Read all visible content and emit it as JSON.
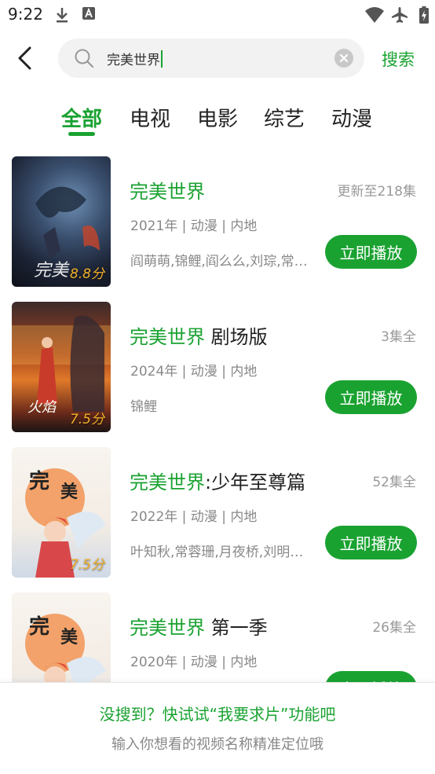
{
  "status_bar": {
    "time": "9:22"
  },
  "search": {
    "query": "完美世界",
    "button_label": "搜索"
  },
  "tabs": [
    {
      "label": "全部",
      "active": true
    },
    {
      "label": "电视",
      "active": false
    },
    {
      "label": "电影",
      "active": false
    },
    {
      "label": "综艺",
      "active": false
    },
    {
      "label": "动漫",
      "active": false
    }
  ],
  "results": [
    {
      "title_highlight": "完美世界",
      "title_rest": "",
      "episodes": "更新至218集",
      "meta": "2021年 | 动漫 | 内地",
      "cast": "阎萌萌,锦鲤,阎么么,刘琮,常…",
      "score": "8.8分",
      "play_label": "立即播放"
    },
    {
      "title_highlight": "完美世界",
      "title_rest": " 剧场版",
      "episodes": "3集全",
      "meta": "2024年 | 动漫 | 内地",
      "cast": "锦鲤",
      "score": "7.5分",
      "play_label": "立即播放"
    },
    {
      "title_highlight": "完美世界",
      "title_rest": ":少年至尊篇",
      "episodes": "52集全",
      "meta": "2022年 | 动漫 | 内地",
      "cast": "叶知秋,常蓉珊,月夜桥,刘明…",
      "score": "7.5分",
      "play_label": "立即播放"
    },
    {
      "title_highlight": "完美世界",
      "title_rest": " 第一季",
      "episodes": "26集全",
      "meta": "2020年 | 动漫 | 内地",
      "cast": "",
      "score": "",
      "play_label": "立即播放"
    }
  ],
  "footer": {
    "prompt": "没搜到？快试试“我要求片”功能吧",
    "hint": "输入你想看的视频名称精准定位哦"
  },
  "colors": {
    "accent": "#1aa231",
    "muted_text": "#888888",
    "score": "#f3b12a"
  }
}
